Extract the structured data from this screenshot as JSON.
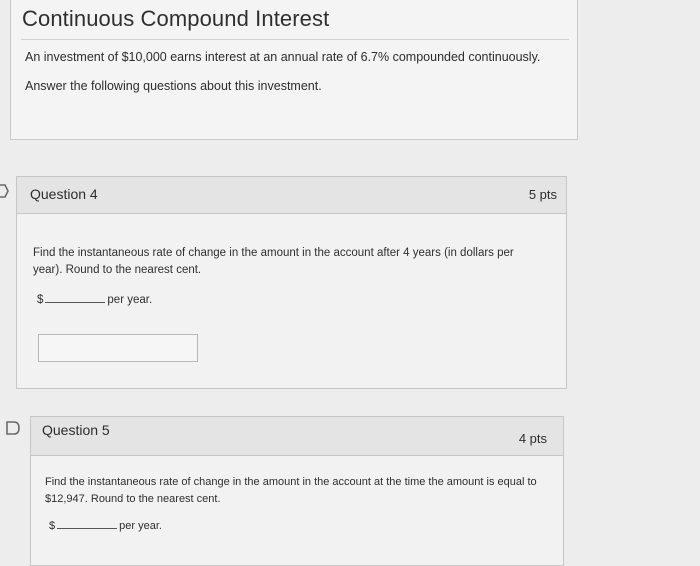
{
  "intro": {
    "title": "Continuous Compound Interest",
    "line1": "An investment of $10,000 earns interest at an annual rate of 6.7% compounded continuously.",
    "line2": "Answer the following questions about this investment."
  },
  "questions": [
    {
      "title": "Question 4",
      "points": "5 pts",
      "text": "Find the instantaneous rate of change in the amount in the account after 4 years (in dollars per year). Round to the nearest cent.",
      "currency": "$",
      "unit": "per year.",
      "answer_value": ""
    },
    {
      "title": "Question 5",
      "points": "4 pts",
      "text": "Find the instantaneous rate of change in the amount in the account at the time the amount is equal to $12,947. Round to the nearest cent.",
      "currency": "$",
      "unit": "per year."
    }
  ],
  "icons": {
    "flag_q4": "flag-outline-icon",
    "flag_q5": "flag-outline-icon"
  }
}
